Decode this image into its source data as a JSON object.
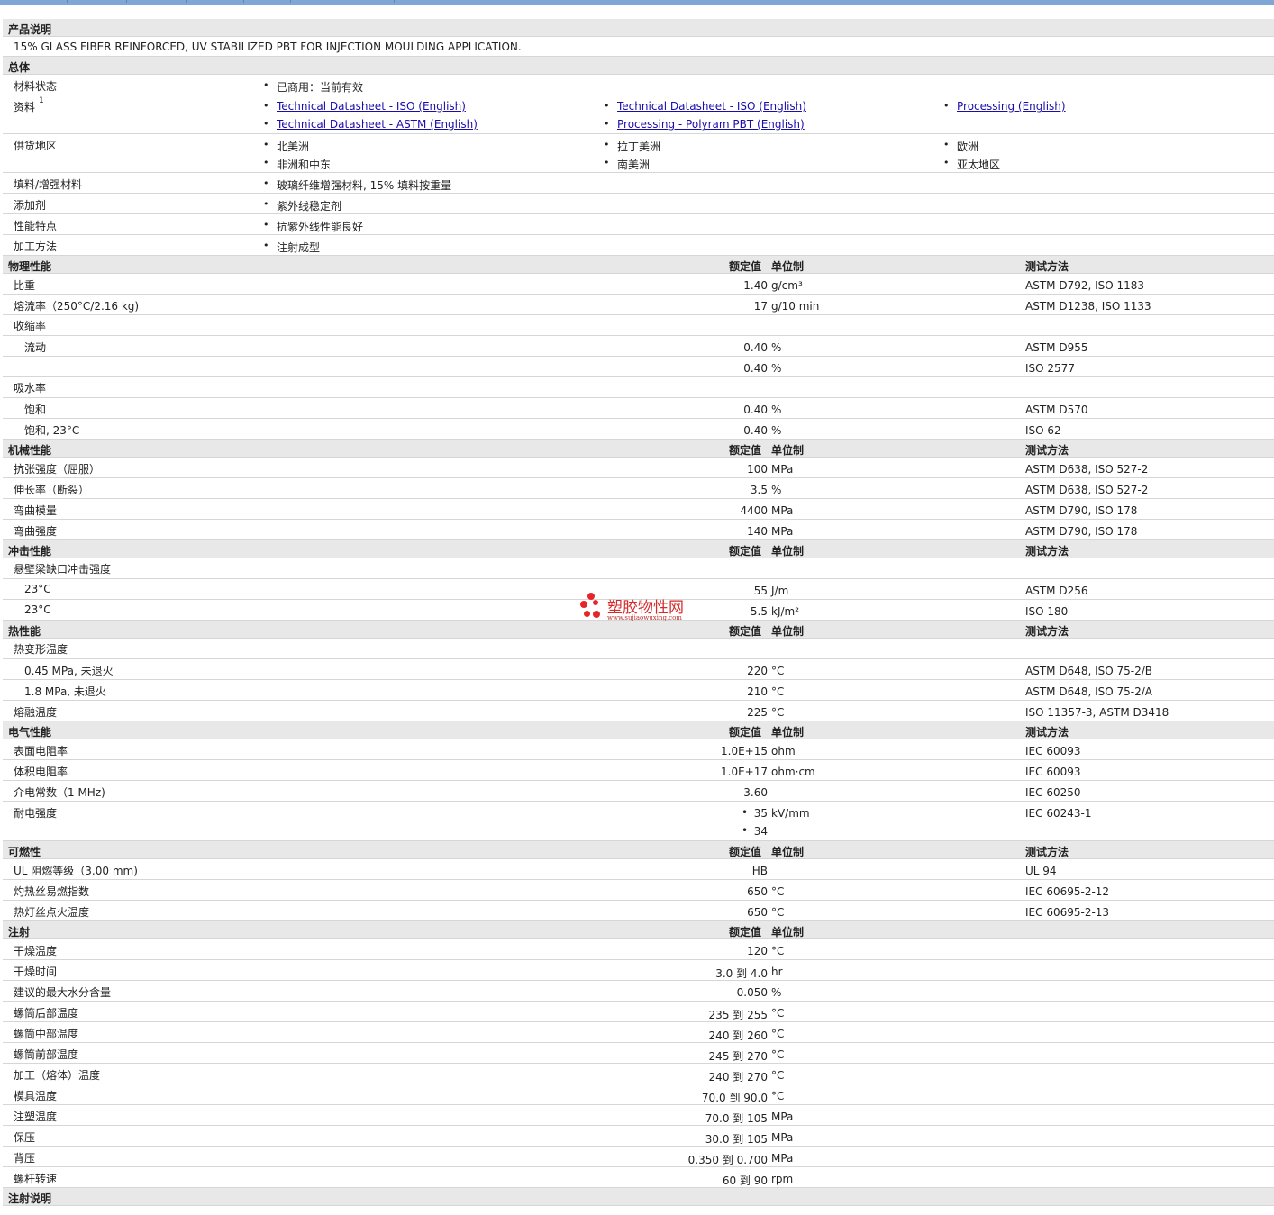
{
  "product_description": {
    "header": "产品说明",
    "text": "15% GLASS FIBER REINFORCED, UV STABILIZED PBT FOR INJECTION MOULDING APPLICATION."
  },
  "general": {
    "header": "总体",
    "rows": [
      {
        "label": "材料状态",
        "items": [
          "已商用：当前有效"
        ]
      },
      {
        "label": "资料",
        "sup": "1",
        "links": [
          "Technical Datasheet - ISO (English)",
          "Technical Datasheet - ISO (English)",
          "Processing (English)",
          "Technical Datasheet - ASTM (English)",
          "Processing - Polyram PBT (English)"
        ]
      },
      {
        "label": "供货地区",
        "items": [
          "北美洲",
          "拉丁美洲",
          "欧洲",
          "非洲和中东",
          "南美洲",
          "亚太地区"
        ]
      },
      {
        "label": "填料/增强材料",
        "items": [
          "玻璃纤维增强材料, 15% 填料按重量"
        ]
      },
      {
        "label": "添加剂",
        "items": [
          "紫外线稳定剂"
        ]
      },
      {
        "label": "性能特点",
        "items": [
          "抗紫外线性能良好"
        ]
      },
      {
        "label": "加工方法",
        "items": [
          "注射成型"
        ]
      }
    ]
  },
  "column_headers": {
    "value": "额定值",
    "unit": "单位制",
    "method": "测试方法"
  },
  "sections": [
    {
      "name": "物理性能",
      "rows": [
        {
          "label": "比重",
          "value": "1.40",
          "unit": "g/cm³",
          "method": "ASTM D792, ISO 1183"
        },
        {
          "label": "熔流率（250°C/2.16 kg)",
          "value": "17",
          "unit": "g/10 min",
          "method": "ASTM D1238, ISO 1133"
        },
        {
          "label": "收缩率"
        },
        {
          "label": "流动",
          "indent": true,
          "value": "0.40",
          "unit": "%",
          "method": "ASTM D955"
        },
        {
          "label": "--",
          "indent": true,
          "value": "0.40",
          "unit": "%",
          "method": "ISO 2577"
        },
        {
          "label": "吸水率"
        },
        {
          "label": "饱和",
          "indent": true,
          "value": "0.40",
          "unit": "%",
          "method": "ASTM D570"
        },
        {
          "label": "饱和, 23°C",
          "indent": true,
          "value": "0.40",
          "unit": "%",
          "method": "ISO 62"
        }
      ]
    },
    {
      "name": "机械性能",
      "rows": [
        {
          "label": "抗张强度（屈服）",
          "value": "100",
          "unit": "MPa",
          "method": "ASTM D638, ISO 527-2"
        },
        {
          "label": "伸长率（断裂）",
          "value": "3.5",
          "unit": "%",
          "method": "ASTM D638, ISO 527-2"
        },
        {
          "label": "弯曲模量",
          "value": "4400",
          "unit": "MPa",
          "method": "ASTM D790, ISO 178"
        },
        {
          "label": "弯曲强度",
          "value": "140",
          "unit": "MPa",
          "method": "ASTM D790, ISO 178"
        }
      ]
    },
    {
      "name": "冲击性能",
      "rows": [
        {
          "label": "悬壁梁缺口冲击强度"
        },
        {
          "label": "23°C",
          "indent": true,
          "value": "55",
          "unit": "J/m",
          "method": "ASTM D256"
        },
        {
          "label": "23°C",
          "indent": true,
          "value": "5.5",
          "unit": "kJ/m²",
          "method": "ISO 180"
        }
      ]
    },
    {
      "name": "热性能",
      "rows": [
        {
          "label": "热变形温度"
        },
        {
          "label": "0.45 MPa, 未退火",
          "indent": true,
          "value": "220",
          "unit": "°C",
          "method": "ASTM D648, ISO 75-2/B"
        },
        {
          "label": "1.8 MPa, 未退火",
          "indent": true,
          "value": "210",
          "unit": "°C",
          "method": "ASTM D648, ISO 75-2/A"
        },
        {
          "label": "熔融温度",
          "value": "225",
          "unit": "°C",
          "method": "ISO 11357-3, ASTM D3418"
        }
      ]
    },
    {
      "name": "电气性能",
      "rows": [
        {
          "label": "表面电阻率",
          "value": "1.0E+15",
          "unit": "ohm",
          "method": "IEC 60093"
        },
        {
          "label": "体积电阻率",
          "value": "1.0E+17",
          "unit": "ohm·cm",
          "method": "IEC 60093"
        },
        {
          "label": "介电常数（1 MHz)",
          "value": "3.60",
          "unit": "",
          "method": "IEC 60250"
        },
        {
          "label": "耐电强度",
          "values": [
            "35",
            "34"
          ],
          "unit": "kV/mm",
          "method": "IEC 60243-1"
        }
      ]
    },
    {
      "name": "可燃性",
      "rows": [
        {
          "label": "UL 阻燃等级（3.00 mm)",
          "value": "HB",
          "unit": "",
          "method": "UL 94"
        },
        {
          "label": "灼热丝易燃指数",
          "value": "650",
          "unit": "°C",
          "method": "IEC 60695-2-12"
        },
        {
          "label": "热灯丝点火温度",
          "value": "650",
          "unit": "°C",
          "method": "IEC 60695-2-13"
        }
      ]
    },
    {
      "name": "注射",
      "no_method": true,
      "rows": [
        {
          "label": "干燥温度",
          "value": "120",
          "unit": "°C"
        },
        {
          "label": "干燥时间",
          "value": "3.0 到  4.0",
          "unit": "hr"
        },
        {
          "label": "建议的最大水分含量",
          "value": "0.050",
          "unit": "%"
        },
        {
          "label": "螺筒后部温度",
          "value": "235 到  255",
          "unit": "°C"
        },
        {
          "label": "螺筒中部温度",
          "value": "240 到  260",
          "unit": "°C"
        },
        {
          "label": "螺筒前部温度",
          "value": "245 到  270",
          "unit": "°C"
        },
        {
          "label": "加工（熔体）温度",
          "value": "240 到  270",
          "unit": "°C"
        },
        {
          "label": "模具温度",
          "value": "70.0 到  90.0",
          "unit": "°C"
        },
        {
          "label": "注塑温度",
          "value": "70.0 到  105",
          "unit": "MPa"
        },
        {
          "label": "保压",
          "value": "30.0 到  105",
          "unit": "MPa"
        },
        {
          "label": "背压",
          "value": "0.350 到  0.700",
          "unit": "MPa"
        },
        {
          "label": "螺杆转速",
          "value": "60 到  90",
          "unit": "rpm"
        }
      ]
    }
  ],
  "injection_notes": {
    "header": "注射说明"
  },
  "watermark": {
    "title": "塑胶物性网",
    "url": "www.sujiaowuxing.com",
    "color": "#e8242b"
  }
}
